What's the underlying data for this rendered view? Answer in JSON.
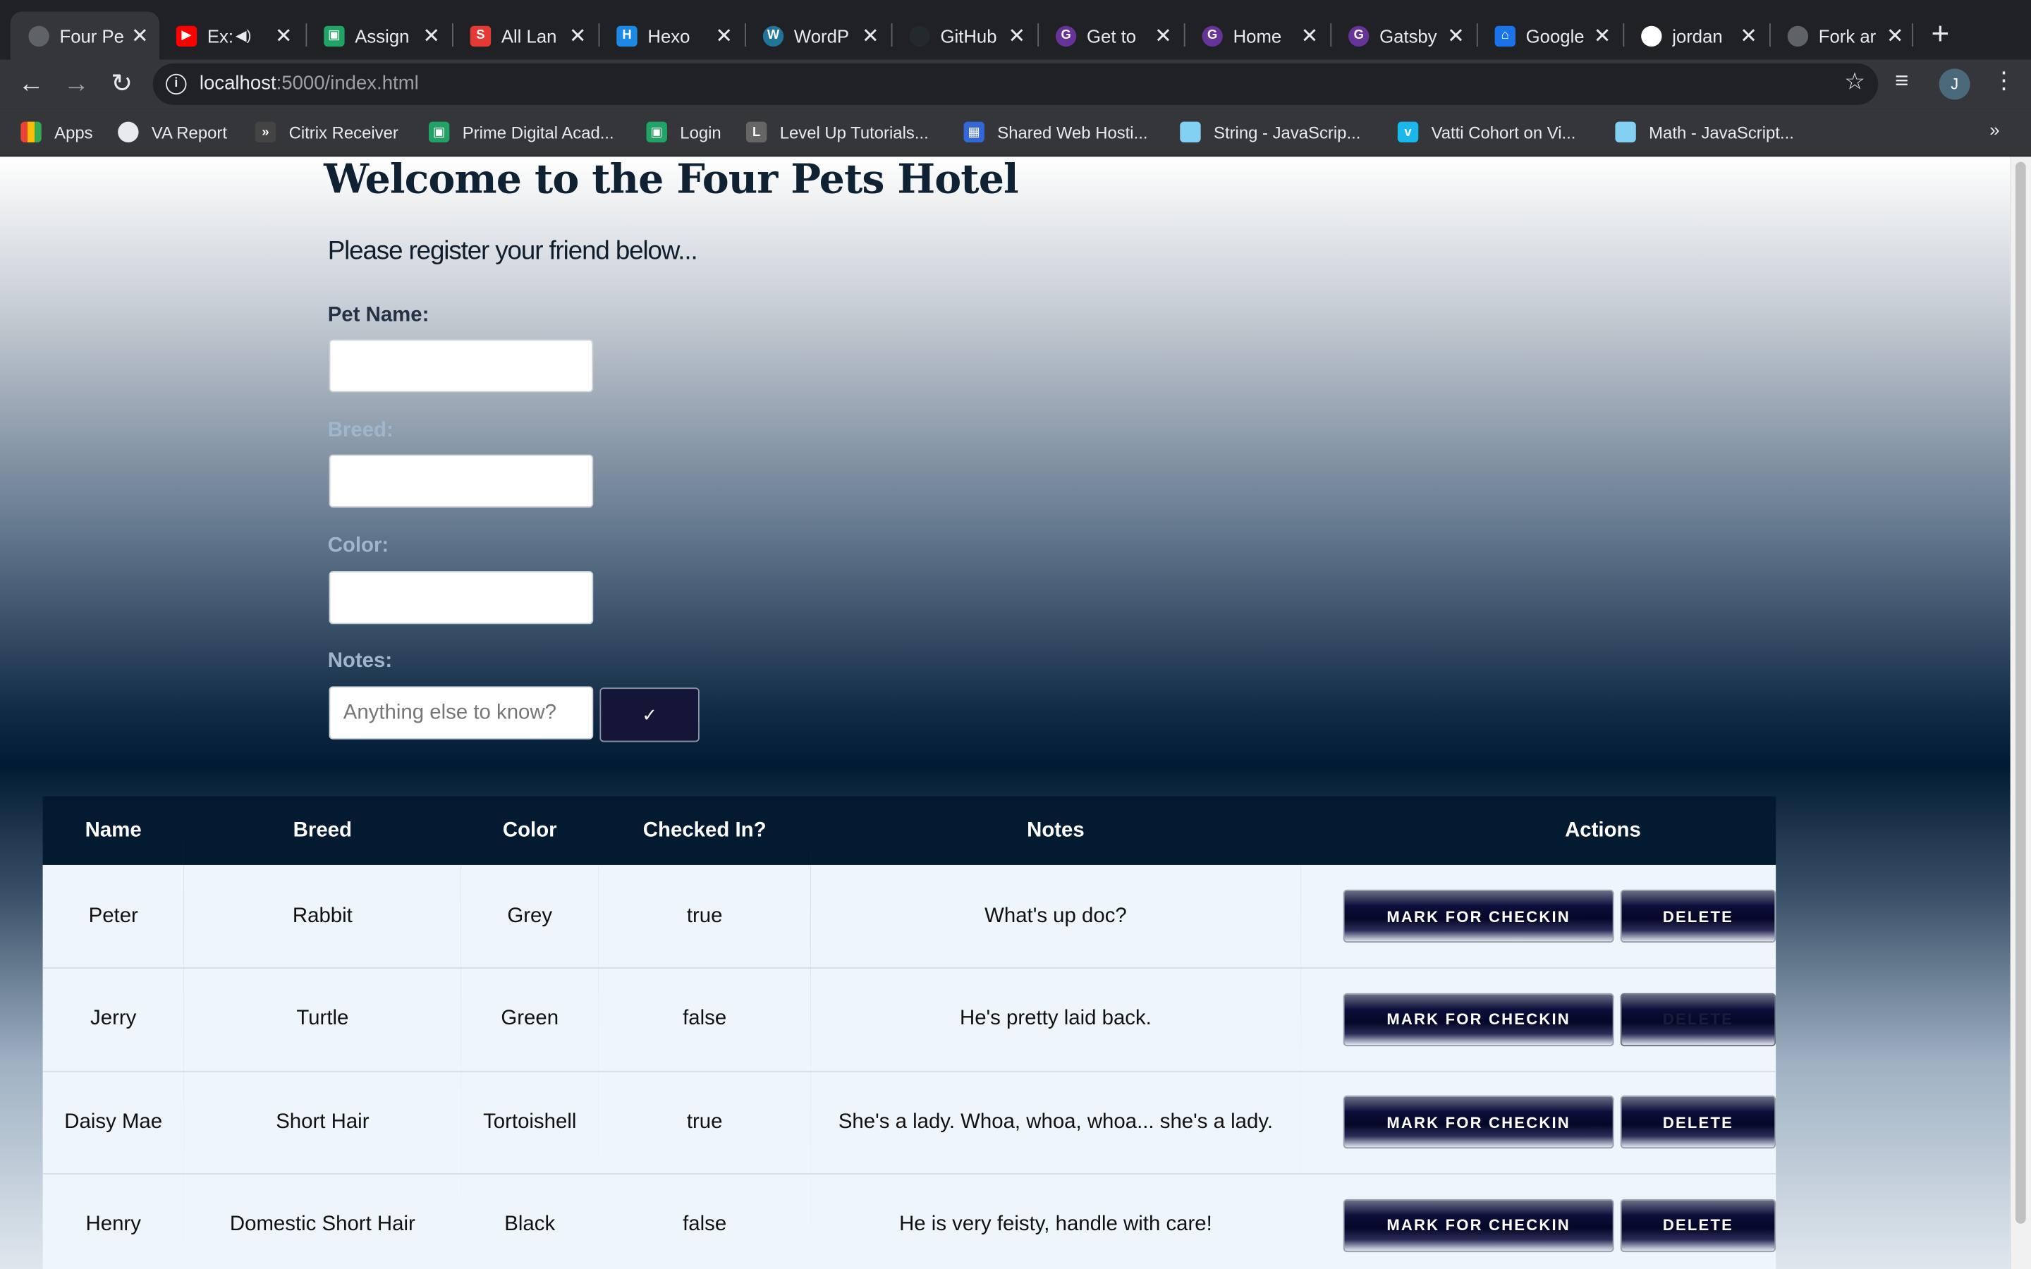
{
  "browser": {
    "tabs": [
      {
        "title": "Four Pe",
        "icon": "globe-icon",
        "color": "#5f6368",
        "active": true
      },
      {
        "title": "Ex:",
        "icon": "youtube-icon",
        "color": "#ff0000",
        "audio": true
      },
      {
        "title": "Assign",
        "icon": "assignment-icon",
        "color": "#21a366"
      },
      {
        "title": "All Lan",
        "icon": "s-icon",
        "color": "#e53935"
      },
      {
        "title": "Hexo",
        "icon": "hexo-icon",
        "color": "#1e88e5"
      },
      {
        "title": "WordP",
        "icon": "wordpress-icon",
        "color": "#21759b"
      },
      {
        "title": "GitHub",
        "icon": "github-icon",
        "color": "#24292e"
      },
      {
        "title": "Get to",
        "icon": "gatsby-icon",
        "color": "#663399"
      },
      {
        "title": "Home",
        "icon": "gatsby-icon",
        "color": "#663399"
      },
      {
        "title": "Gatsby",
        "icon": "gatsby-icon",
        "color": "#663399"
      },
      {
        "title": "Google",
        "icon": "google-icon",
        "color": "#1a73e8"
      },
      {
        "title": "jordan",
        "icon": "github-icon",
        "color": "#24292e"
      },
      {
        "title": "Fork ar",
        "icon": "globe-icon",
        "color": "#5f6368"
      }
    ],
    "url_host": "localhost",
    "url_rest": ":5000/index.html",
    "avatar_letter": "J"
  },
  "bookmarks": [
    {
      "label": "Apps",
      "icon": "apps-grid-icon",
      "color": "#ea4335"
    },
    {
      "label": "VA Report",
      "icon": "globe-icon",
      "color": "#5f6368"
    },
    {
      "label": "Citrix Receiver",
      "icon": "citrix-icon",
      "color": "#444"
    },
    {
      "label": "Prime Digital Acad...",
      "icon": "prime-icon",
      "color": "#21a366"
    },
    {
      "label": "Login",
      "icon": "prime-icon",
      "color": "#21a366"
    },
    {
      "label": "Level Up Tutorials...",
      "icon": "levelup-icon",
      "color": "#666"
    },
    {
      "label": "Shared Web Hosti...",
      "icon": "grid-icon",
      "color": "#3367d6"
    },
    {
      "label": "String - JavaScrip...",
      "icon": "mdn-icon",
      "color": "#83d0f2"
    },
    {
      "label": "Vatti Cohort on Vi...",
      "icon": "vimeo-icon",
      "color": "#1ab7ea"
    },
    {
      "label": "Math - JavaScript...",
      "icon": "mdn-icon",
      "color": "#83d0f2"
    }
  ],
  "page": {
    "title": "Welcome to the Four Pets Hotel",
    "subtitle": "Please register your friend below...",
    "form": {
      "pet_name_label": "Pet Name:",
      "breed_label": "Breed:",
      "color_label": "Color:",
      "notes_label": "Notes:",
      "notes_placeholder": "Anything else to know?",
      "submit_label": "✓"
    },
    "table": {
      "headers": [
        "Name",
        "Breed",
        "Color",
        "Checked In?",
        "Notes",
        "Actions"
      ],
      "checkin_label": "MARK FOR CHECKIN",
      "delete_label": "DELETE",
      "rows": [
        {
          "name": "Peter",
          "breed": "Rabbit",
          "color": "Grey",
          "checked_in": "true",
          "notes": "What's up doc?"
        },
        {
          "name": "Jerry",
          "breed": "Turtle",
          "color": "Green",
          "checked_in": "false",
          "notes": "He's pretty laid back."
        },
        {
          "name": "Daisy Mae",
          "breed": "Short Hair",
          "color": "Tortoishell",
          "checked_in": "true",
          "notes": "She's a lady. Whoa, whoa, whoa... she's a lady."
        },
        {
          "name": "Henry",
          "breed": "Domestic Short Hair",
          "color": "Black",
          "checked_in": "false",
          "notes": "He is very feisty, handle with care!"
        }
      ]
    }
  }
}
